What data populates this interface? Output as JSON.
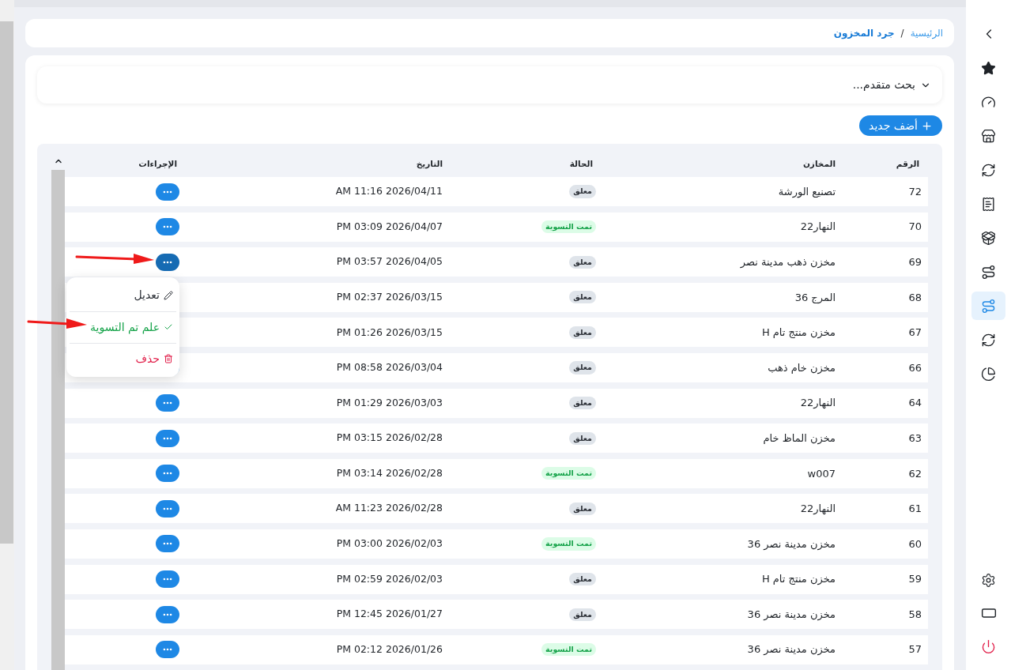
{
  "breadcrumb": {
    "items": [
      {
        "label": "الرئيسية",
        "current": false
      },
      {
        "label": "جرد المخزون",
        "current": true
      }
    ],
    "separator": "/"
  },
  "search": {
    "label": "بحث متقدم...",
    "expanded": false
  },
  "add_button": {
    "label": "أضف جديد"
  },
  "table": {
    "columns": [
      "الرقم",
      "المخازن",
      "الحالة",
      "التاريخ",
      "الإجراءات"
    ],
    "rows": [
      {
        "number": "72",
        "warehouse": "تصنيع الورشة",
        "status": {
          "label": "معلق",
          "kind": "pending"
        },
        "date": "AM 11:16 2026/04/11",
        "menu_open": false
      },
      {
        "number": "70",
        "warehouse": "النهار22",
        "status": {
          "label": "تمت التسوية",
          "kind": "settled"
        },
        "date": "PM 03:09 2026/04/07",
        "menu_open": false
      },
      {
        "number": "69",
        "warehouse": "مخزن ذهب مدينة نصر",
        "status": {
          "label": "معلق",
          "kind": "pending"
        },
        "date": "PM 03:57 2026/04/05",
        "menu_open": true
      },
      {
        "number": "68",
        "warehouse": "المرج 36",
        "status": {
          "label": "معلق",
          "kind": "pending"
        },
        "date": "PM 02:37 2026/03/15",
        "menu_open": false
      },
      {
        "number": "67",
        "warehouse": "مخزن منتج تام H",
        "status": {
          "label": "معلق",
          "kind": "pending"
        },
        "date": "PM 01:26 2026/03/15",
        "menu_open": false
      },
      {
        "number": "66",
        "warehouse": "مخزن خام ذهب",
        "status": {
          "label": "معلق",
          "kind": "pending"
        },
        "date": "PM 08:58 2026/03/04",
        "menu_open": false
      },
      {
        "number": "64",
        "warehouse": "النهار22",
        "status": {
          "label": "معلق",
          "kind": "pending"
        },
        "date": "PM 01:29 2026/03/03",
        "menu_open": false
      },
      {
        "number": "63",
        "warehouse": "مخزن الماظ خام",
        "status": {
          "label": "معلق",
          "kind": "pending"
        },
        "date": "PM 03:15 2026/02/28",
        "menu_open": false
      },
      {
        "number": "62",
        "warehouse": "w007",
        "status": {
          "label": "تمت التسوية",
          "kind": "settled"
        },
        "date": "PM 03:14 2026/02/28",
        "menu_open": false
      },
      {
        "number": "61",
        "warehouse": "النهار22",
        "status": {
          "label": "معلق",
          "kind": "pending"
        },
        "date": "AM 11:23 2026/02/28",
        "menu_open": false
      },
      {
        "number": "60",
        "warehouse": "مخزن مدينة نصر 36",
        "status": {
          "label": "تمت التسوية",
          "kind": "settled"
        },
        "date": "PM 03:00 2026/02/03",
        "menu_open": false
      },
      {
        "number": "59",
        "warehouse": "مخزن منتج تام H",
        "status": {
          "label": "معلق",
          "kind": "pending"
        },
        "date": "PM 02:59 2026/02/03",
        "menu_open": false
      },
      {
        "number": "58",
        "warehouse": "مخزن مدينة نصر 36",
        "status": {
          "label": "معلق",
          "kind": "pending"
        },
        "date": "PM 12:45 2026/01/27",
        "menu_open": false
      },
      {
        "number": "57",
        "warehouse": "مخزن مدينة نصر 36",
        "status": {
          "label": "تمت التسوية",
          "kind": "settled"
        },
        "date": "PM 02:12 2026/01/26",
        "menu_open": false
      }
    ]
  },
  "action_menu": {
    "items": [
      {
        "label": "تعديل",
        "kind": "edit"
      },
      {
        "label": "علم تم التسوية",
        "kind": "settle"
      },
      {
        "label": "حذف",
        "kind": "delete"
      }
    ]
  },
  "sidebar": {
    "items": [
      {
        "selected": false
      },
      {
        "selected": false
      },
      {
        "selected": false
      },
      {
        "selected": false
      },
      {
        "selected": false
      },
      {
        "selected": false
      },
      {
        "selected": false
      },
      {
        "selected": true
      },
      {
        "selected": false
      },
      {
        "selected": false
      }
    ]
  }
}
